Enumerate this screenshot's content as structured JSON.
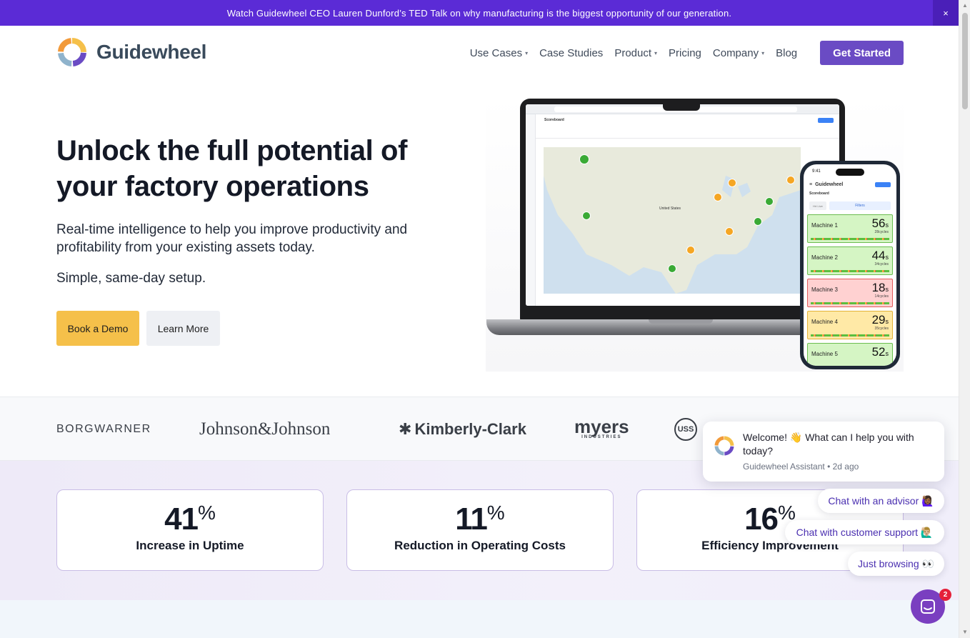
{
  "announcement": {
    "text": "Watch Guidewheel CEO Lauren Dunford’s TED Talk on why manufacturing is the biggest opportunity of our generation.",
    "close": "×"
  },
  "brand": {
    "name": "Guidewheel"
  },
  "nav": {
    "items": [
      {
        "label": "Use Cases",
        "has_caret": true
      },
      {
        "label": "Case Studies",
        "has_caret": false
      },
      {
        "label": "Product",
        "has_caret": true
      },
      {
        "label": "Pricing",
        "has_caret": false
      },
      {
        "label": "Company",
        "has_caret": true
      },
      {
        "label": "Blog",
        "has_caret": false
      }
    ],
    "caret": "▾",
    "cta": "Get Started"
  },
  "hero": {
    "title": "Unlock the full potential of your factory operations",
    "subtitle": "Real-time intelligence to help you improve productivity and profitability from your existing assets today.",
    "subtitle2": "Simple, same-day setup.",
    "primary_button": "Book a Demo",
    "secondary_button": "Learn More"
  },
  "device_mockup": {
    "phone": {
      "time": "9:41",
      "app_name": "Guidewheel",
      "section": "Scoreboard",
      "filter_label": "Filters",
      "filter_tab": "Hrt Live",
      "machines": [
        {
          "name": "Machine 1",
          "value": "56",
          "unit": "s",
          "cycles": "28cycles",
          "status": "green"
        },
        {
          "name": "Machine 2",
          "value": "44",
          "unit": "s",
          "cycles": "34cycles",
          "status": "green"
        },
        {
          "name": "Machine 3",
          "value": "18",
          "unit": "s",
          "cycles": "14cycles",
          "status": "red"
        },
        {
          "name": "Machine 4",
          "value": "29",
          "unit": "s",
          "cycles": "35cycles",
          "status": "yellow"
        },
        {
          "name": "Machine 5",
          "value": "52",
          "unit": "s",
          "cycles": "",
          "status": "green"
        }
      ]
    },
    "laptop": {
      "dashboard_title": "Scoreboard",
      "map_label": "United States"
    }
  },
  "customer_logos": [
    {
      "name": "BORGWARNER"
    },
    {
      "name": "Johnson&Johnson"
    },
    {
      "name": "Kimberly-Clark"
    },
    {
      "name": "myers",
      "sub": "INDUSTRIES"
    },
    {
      "name": "USS"
    }
  ],
  "stats": [
    {
      "number": "41",
      "suffix": "%",
      "label": "Increase in Uptime"
    },
    {
      "number": "11",
      "suffix": "%",
      "label": "Reduction in Operating Costs"
    },
    {
      "number": "16",
      "suffix": "%",
      "label": "Efficiency Improvement"
    }
  ],
  "chat": {
    "message": "Welcome! 👋 What can I help you with today?",
    "meta": "Guidewheel Assistant • 2d ago",
    "options": [
      "Chat with an advisor 🙋🏾‍♀️",
      "Chat with customer support 🙋🏼‍♂️",
      "Just browsing 👀"
    ],
    "badge": "2"
  },
  "colors": {
    "announcement_bg": "#5b2bd6",
    "cta_purple": "#6a4bc4",
    "demo_yellow": "#f5c04a",
    "stat_border": "#c9bde6",
    "chat_launcher": "#7a3fc0"
  }
}
